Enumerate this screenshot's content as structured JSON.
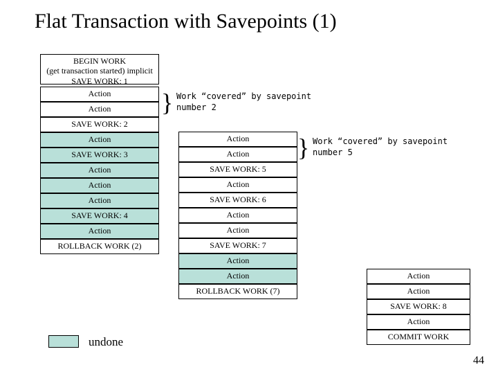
{
  "title": "Flat Transaction with Savepoints (1)",
  "begin_block": "BEGIN WORK\n(get transaction started) implicit\nSAVE WORK: 1",
  "col1": [
    {
      "t": "Action",
      "u": false
    },
    {
      "t": "Action",
      "u": false
    },
    {
      "t": "SAVE WORK: 2",
      "u": false
    },
    {
      "t": "Action",
      "u": true
    },
    {
      "t": "SAVE WORK: 3",
      "u": true
    },
    {
      "t": "Action",
      "u": true
    },
    {
      "t": "Action",
      "u": true
    },
    {
      "t": "Action",
      "u": true
    },
    {
      "t": "SAVE WORK: 4",
      "u": true
    },
    {
      "t": "Action",
      "u": true
    },
    {
      "t": "ROLLBACK WORK (2)",
      "u": false
    }
  ],
  "col2": [
    {
      "t": "Action",
      "u": false
    },
    {
      "t": "Action",
      "u": false
    },
    {
      "t": "SAVE WORK: 5",
      "u": false
    },
    {
      "t": "Action",
      "u": false
    },
    {
      "t": "SAVE WORK: 6",
      "u": false
    },
    {
      "t": "Action",
      "u": false
    },
    {
      "t": "Action",
      "u": false
    },
    {
      "t": "SAVE WORK: 7",
      "u": false
    },
    {
      "t": "Action",
      "u": true
    },
    {
      "t": "Action",
      "u": true
    },
    {
      "t": "ROLLBACK WORK (7)",
      "u": false
    }
  ],
  "col3": [
    {
      "t": "Action",
      "u": false
    },
    {
      "t": "Action",
      "u": false
    },
    {
      "t": "SAVE WORK: 8",
      "u": false
    },
    {
      "t": "Action",
      "u": false
    },
    {
      "t": "COMMIT WORK",
      "u": false
    }
  ],
  "anno1": "Work “covered” by savepoint\nnumber 2",
  "anno2": "Work “covered” by savepoint\nnumber 5",
  "legend": "undone",
  "page_number": "44",
  "chart_data": {
    "type": "table",
    "title": "Flat Transaction with Savepoints (1)",
    "columns": [
      "col1",
      "col2",
      "col3"
    ],
    "begin_block": [
      "BEGIN WORK",
      "(get transaction started) implicit",
      "SAVE WORK: 1"
    ],
    "col1_rows": [
      "Action",
      "Action",
      "SAVE WORK: 2",
      "Action",
      "SAVE WORK: 3",
      "Action",
      "Action",
      "Action",
      "SAVE WORK: 4",
      "Action",
      "ROLLBACK WORK (2)"
    ],
    "col1_undone_indices": [
      3,
      4,
      5,
      6,
      7,
      8,
      9
    ],
    "col2_rows": [
      "Action",
      "Action",
      "SAVE WORK: 5",
      "Action",
      "SAVE WORK: 6",
      "Action",
      "Action",
      "SAVE WORK: 7",
      "Action",
      "Action",
      "ROLLBACK WORK (7)"
    ],
    "col2_undone_indices": [
      8,
      9
    ],
    "col3_rows": [
      "Action",
      "Action",
      "SAVE WORK: 8",
      "Action",
      "COMMIT WORK"
    ],
    "col3_undone_indices": [],
    "annotations": [
      {
        "text": "Work \"covered\" by savepoint number 2",
        "applies_to": "col1 rows 0-1"
      },
      {
        "text": "Work \"covered\" by savepoint number 5",
        "applies_to": "col2 rows 0-1"
      }
    ],
    "legend": {
      "undone_color": "#b9e0d9",
      "label": "undone"
    }
  }
}
